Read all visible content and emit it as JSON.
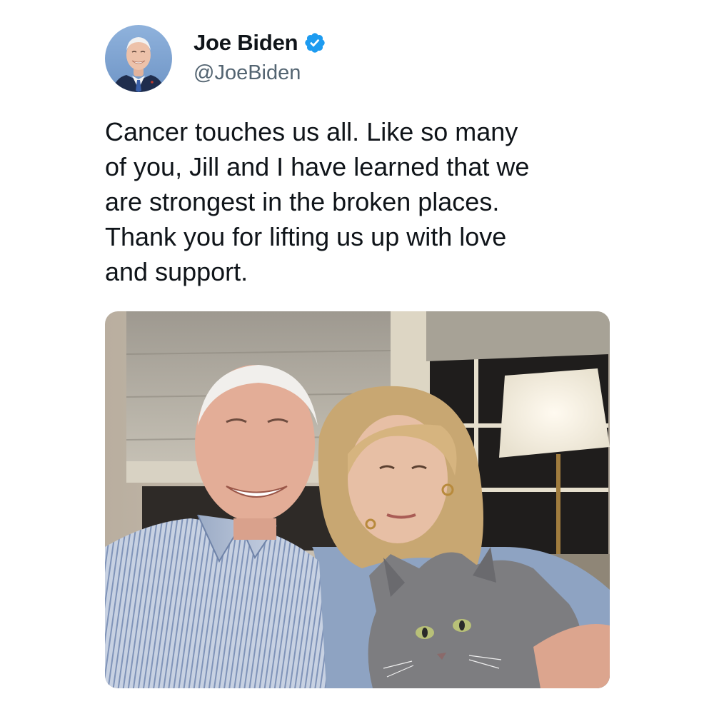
{
  "author": {
    "display_name": "Joe Biden",
    "handle": "@JoeBiden",
    "verified": true,
    "verified_color": "#1d9bf0"
  },
  "tweet": {
    "text_lines": [
      "Cancer touches us all. Like so many",
      "of you, Jill and I have learned that we",
      "are strongest in the broken places.",
      "Thank you for lifting us up with love",
      "and support."
    ]
  },
  "media": {
    "kind": "photo"
  },
  "colors": {
    "text_primary": "#0f1419",
    "text_secondary": "#536471",
    "background": "#ffffff"
  },
  "icons": {
    "verified": "verified-badge-icon"
  }
}
